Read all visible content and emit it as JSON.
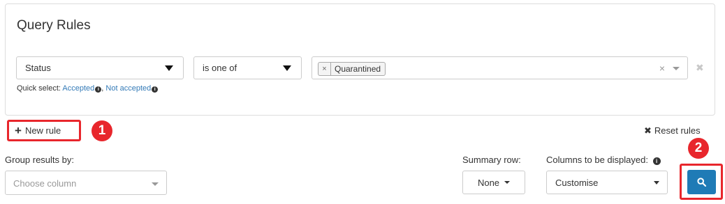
{
  "query_rules": {
    "title": "Query Rules",
    "rule": {
      "field": "Status",
      "operator": "is one of",
      "values": [
        "Quarantined"
      ],
      "tag_remove_glyph": "×",
      "clear_glyph": "×",
      "remove_rule_glyph": "✖"
    },
    "quick_select": {
      "prefix": "Quick select:",
      "options": [
        "Accepted",
        "Not accepted"
      ],
      "separator": ","
    }
  },
  "actions": {
    "new_rule_label": "New rule",
    "new_rule_icon": "+",
    "reset_rules_label": "Reset rules",
    "reset_rules_icon": "✖"
  },
  "annotations": {
    "badge_1": "1",
    "badge_2": "2",
    "highlight_color": "#e8262c"
  },
  "controls": {
    "group_results_label": "Group results by:",
    "group_results_placeholder": "Choose column",
    "summary_row_label": "Summary row:",
    "summary_row_value": "None",
    "columns_label": "Columns to be displayed:",
    "columns_value": "Customise",
    "search_button_color": "#1f7bb6",
    "search_icon": "search-icon"
  }
}
